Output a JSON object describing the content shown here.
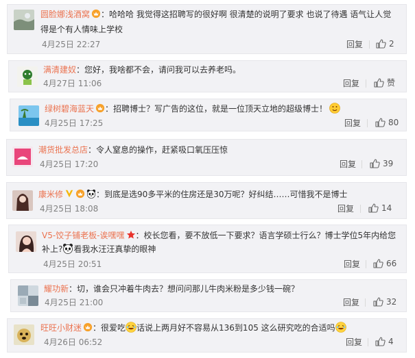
{
  "icons": {
    "like": "thumbs-up-icon",
    "vip": "vip-crown-icon",
    "emoji_laugh": "laughing-emoji-icon",
    "emoji_panda": "panda-emoji-icon",
    "emoji_star": "star-badge-icon",
    "emoji_v": "v-badge-icon"
  },
  "colors": {
    "username": "#eb7350",
    "meta": "#808080",
    "background": "#f2f2f5"
  },
  "comments": [
    {
      "user": "圆脸娜浅酒窝",
      "text_line1": "：哈哈哈 我觉得这招聘写的很好啊 很清楚的说明了要求 也说了待遇 语气让人觉",
      "text_line2": "得是个有人情味上学校",
      "date": "4月25日 22:27",
      "reply": "回复",
      "likes": "2"
    },
    {
      "user": "满清建奴",
      "text_line1": "：您好，我啥都不会，请问我可以去养老吗。",
      "date": "4月27日 11:06",
      "reply": "回复",
      "likes": "赞"
    },
    {
      "user": "绿树碧海蓝天",
      "text_line1": "：招聘博士？写广告的这位，就是一位顶天立地的超级博士！",
      "date": "4月25日 17:25",
      "reply": "回复",
      "likes": "80"
    },
    {
      "user": "潮货批发总店",
      "text_line1": "：令人窒息的操作，赶紧吸口氧压压惊",
      "date": "4月25日 17:20",
      "reply": "回复",
      "likes": "39"
    },
    {
      "user": "康米修",
      "text_line1": "：到底是选90多平米的住房还是30万呢？好纠结……可惜我不是博士",
      "date": "4月25日 18:08",
      "reply": "回复",
      "likes": "14"
    },
    {
      "user": "V5-饺子铺老板-诶嘿嘿",
      "text_line1": "：校长您看，要不放低一下要求？语言学硕士行么？博士学位5年内给您",
      "text_line2a": "补上?",
      "text_line2b": "看我水汪汪真挚的眼神",
      "date": "4月25日 20:51",
      "reply": "回复",
      "likes": "66"
    },
    {
      "user": "耀功新",
      "text_line1": "：切，谁会只冲着牛肉去？想问问那儿牛肉米粉是多少钱一碗？",
      "date": "4月25日 21:00",
      "reply": "回复",
      "likes": "32"
    },
    {
      "user": "旺旺小财迷",
      "text_line1a": "：很爱吃",
      "text_line1b": "话说上两月好不容易从136到105 这么研究吃的合适吗",
      "date": "4月26日 06:52",
      "reply": "回复",
      "likes": "4"
    }
  ]
}
